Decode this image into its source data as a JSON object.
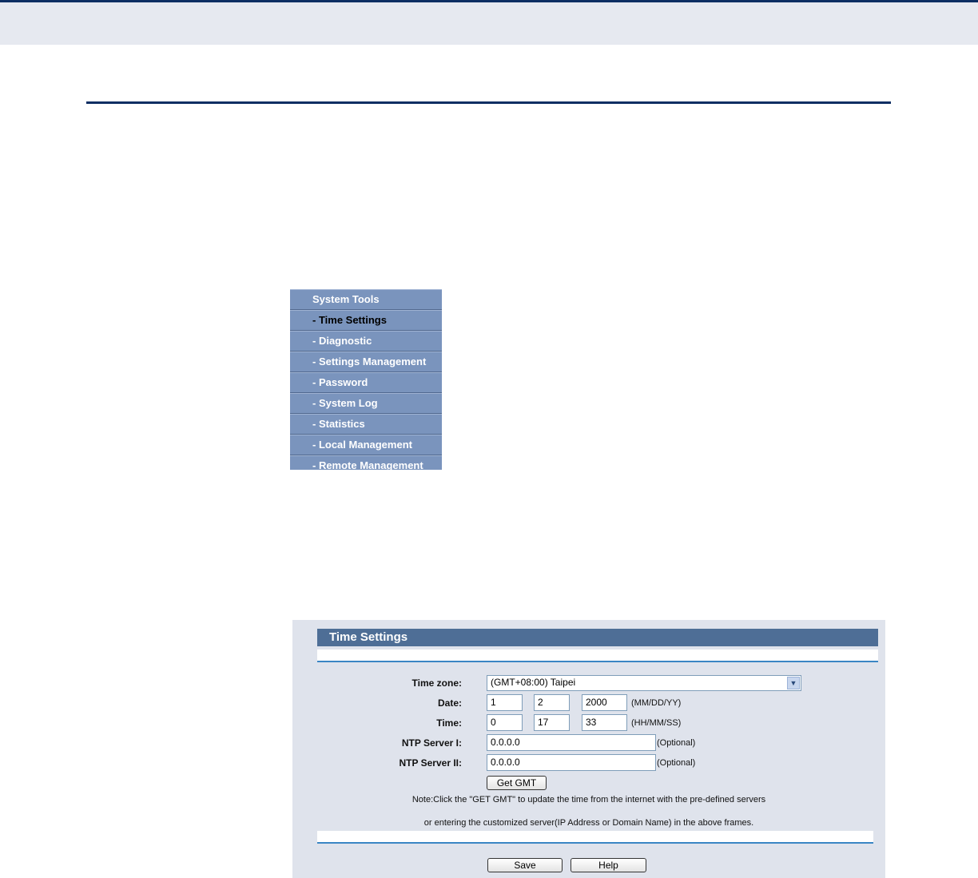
{
  "menu": {
    "items": [
      {
        "label": "System Tools"
      },
      {
        "label": "- Time Settings"
      },
      {
        "label": "- Diagnostic"
      },
      {
        "label": "- Settings Management"
      },
      {
        "label": "- Password"
      },
      {
        "label": "- System Log"
      },
      {
        "label": "- Statistics"
      },
      {
        "label": "- Local Management"
      },
      {
        "label": "- Remote Management"
      }
    ]
  },
  "panel": {
    "title": "Time Settings",
    "timezone": {
      "label": "Time zone:",
      "value": "(GMT+08:00) Taipei"
    },
    "date": {
      "label": "Date:",
      "month": "1",
      "day": "2",
      "year": "2000",
      "format": "(MM/DD/YY)"
    },
    "time": {
      "label": "Time:",
      "hour": "0",
      "minute": "17",
      "second": "33",
      "format": "(HH/MM/SS)"
    },
    "ntp1": {
      "label": "NTP Server I:",
      "value": "0.0.0.0",
      "hint": "(Optional)"
    },
    "ntp2": {
      "label": "NTP Server II:",
      "value": "0.0.0.0",
      "hint": "(Optional)"
    },
    "get_gmt_label": "Get GMT",
    "note_line1": "Note:Click the \"GET GMT\" to update the time from the internet with the pre-defined servers",
    "note_line2": "or entering the customized server(IP Address or Domain Name) in the above frames.",
    "save_label": "Save",
    "help_label": "Help"
  }
}
